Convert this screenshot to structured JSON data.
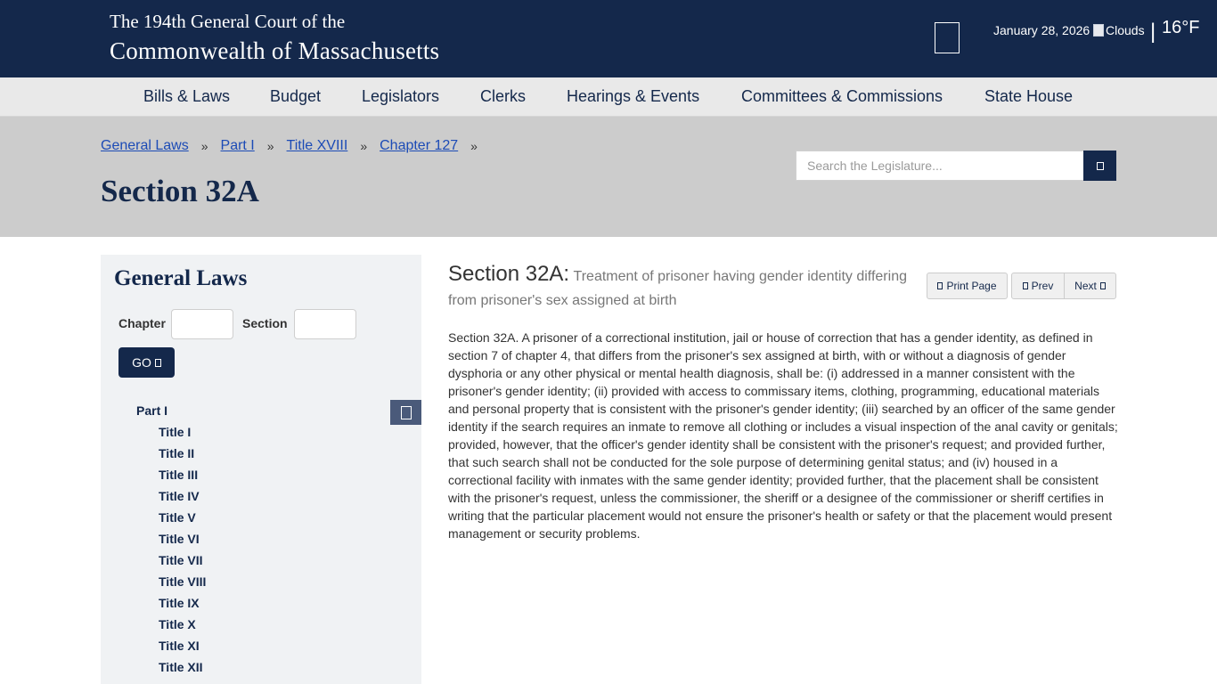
{
  "header": {
    "line1": "The 194th General Court of the",
    "line2": "Commonwealth of Massachusetts",
    "date": "January 28, 2026",
    "weather_alt": "Clouds",
    "temperature": "16°F"
  },
  "nav": {
    "items": [
      "Bills & Laws",
      "Budget",
      "Legislators",
      "Clerks",
      "Hearings & Events",
      "Committees & Commissions",
      "State House"
    ]
  },
  "breadcrumb": {
    "items": [
      "General Laws",
      "Part I",
      "Title XVIII",
      "Chapter 127"
    ],
    "separator": "»"
  },
  "page": {
    "title": "Section 32A"
  },
  "search": {
    "placeholder": "Search the Legislature..."
  },
  "sidebar": {
    "title": "General Laws",
    "chapter_label": "Chapter",
    "section_label": "Section",
    "go_label": "GO",
    "part": "Part I",
    "titles": [
      "Title I",
      "Title II",
      "Title III",
      "Title IV",
      "Title V",
      "Title VI",
      "Title VII",
      "Title VIII",
      "Title IX",
      "Title X",
      "Title XI",
      "Title XII"
    ]
  },
  "content": {
    "section_number": "Section 32A:",
    "section_caption": "Treatment of prisoner having gender identity differing from prisoner's sex assigned at birth",
    "print_label": "Print Page",
    "prev_label": "Prev",
    "next_label": "Next",
    "body": "Section 32A. A prisoner of a correctional institution, jail or house of correction that has a gender identity, as defined in section 7 of chapter 4, that differs from the prisoner's sex assigned at birth, with or without a diagnosis of gender dysphoria or any other physical or mental health diagnosis, shall be: (i) addressed in a manner consistent with the prisoner's gender identity; (ii) provided with access to commissary items, clothing, programming, educational materials and personal property that is consistent with the prisoner's gender identity; (iii) searched by an officer of the same gender identity if the search requires an inmate to remove all clothing or includes a visual inspection of the anal cavity or genitals; provided, however, that the officer's gender identity shall be consistent with the prisoner's request; and provided further, that such search shall not be conducted for the sole purpose of determining genital status; and (iv) housed in a correctional facility with inmates with the same gender identity; provided further, that the placement shall be consistent with the prisoner's request, unless the commissioner, the sheriff or a designee of the commissioner or sheriff certifies in writing that the particular placement would not ensure the prisoner's health or safety or that the placement would present management or security problems."
  },
  "colors": {
    "navy": "#14284b",
    "link": "#1c4bb6",
    "banner_gray": "#cccccc",
    "nav_gray": "#e9e9e9",
    "sidebar_bg": "#f0f2f4"
  },
  "icons": {
    "menu": "menu-icon",
    "weather": "weather-icon",
    "search": "search-icon",
    "go": "arrow-right-icon",
    "tree_toggle": "collapse-icon",
    "print": "print-icon",
    "prev": "chevron-left-icon",
    "next": "chevron-right-icon"
  }
}
